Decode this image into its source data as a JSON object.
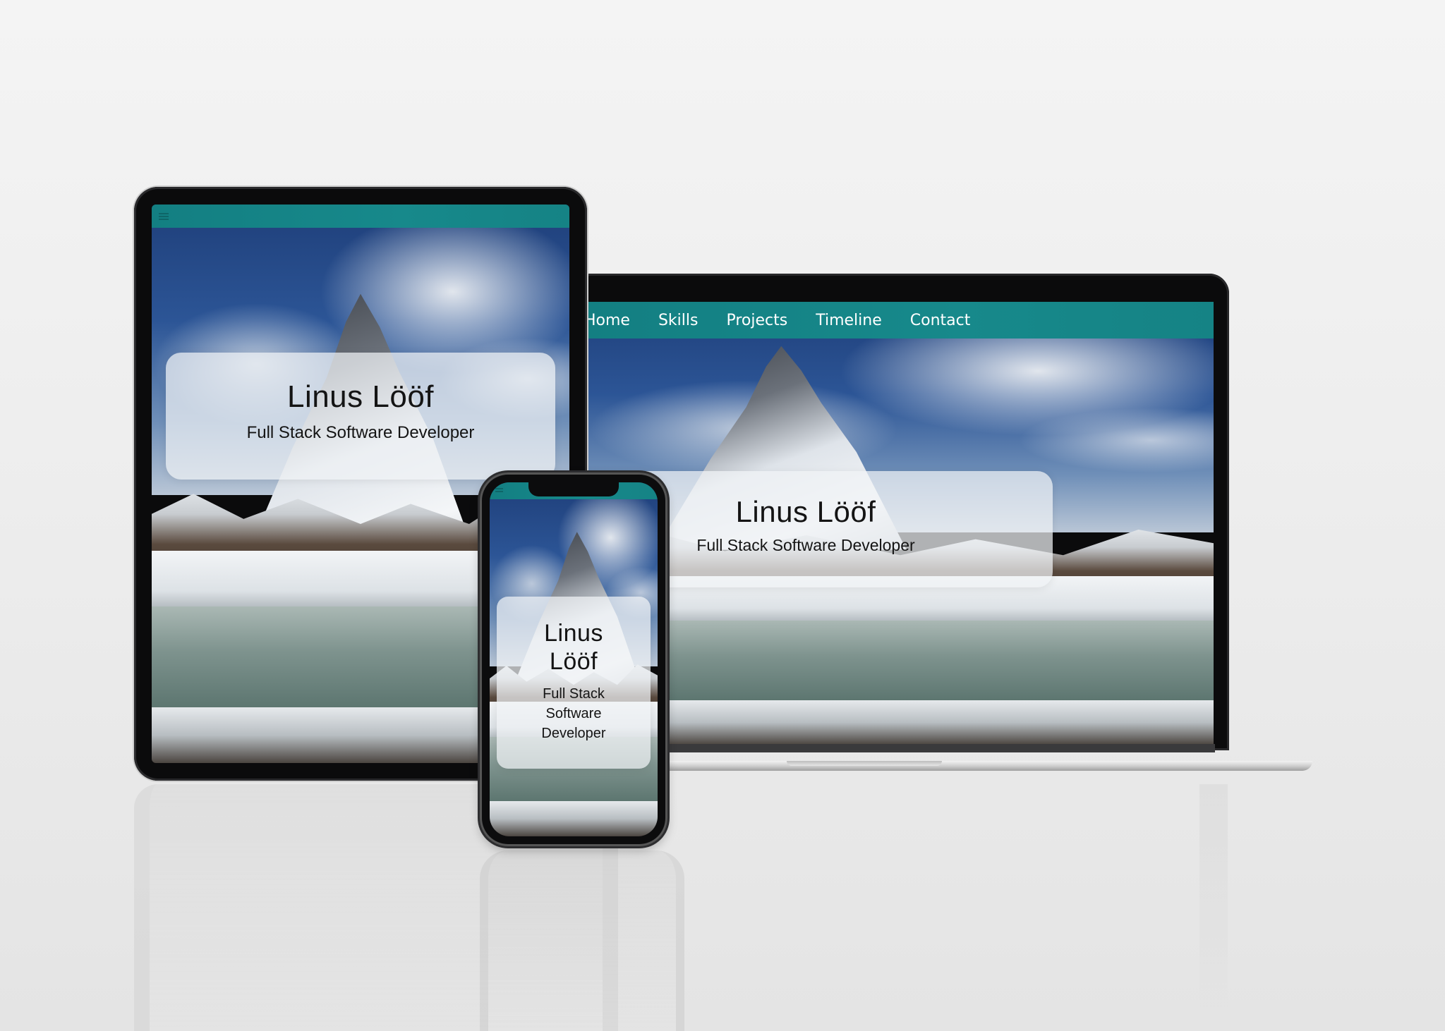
{
  "colors": {
    "navbar_teal": "#17898b",
    "device_frame": "#0b0b0c",
    "background": "#eeeeee",
    "hero_card": "rgba(240,242,245,0.72)"
  },
  "icons": {
    "menu": "hamburger-menu-icon"
  },
  "laptop": {
    "nav": [
      "Home",
      "Skills",
      "Projects",
      "Timeline",
      "Contact"
    ],
    "hero": {
      "name": "Linus Lööf",
      "role": "Full Stack Software Developer"
    }
  },
  "tablet": {
    "hero": {
      "name": "Linus Lööf",
      "role": "Full Stack Software Developer"
    }
  },
  "phone": {
    "hero": {
      "name_line1": "Linus",
      "name_line2": "Lööf",
      "role_line1": "Full Stack",
      "role_line2": "Software",
      "role_line3": "Developer"
    }
  }
}
